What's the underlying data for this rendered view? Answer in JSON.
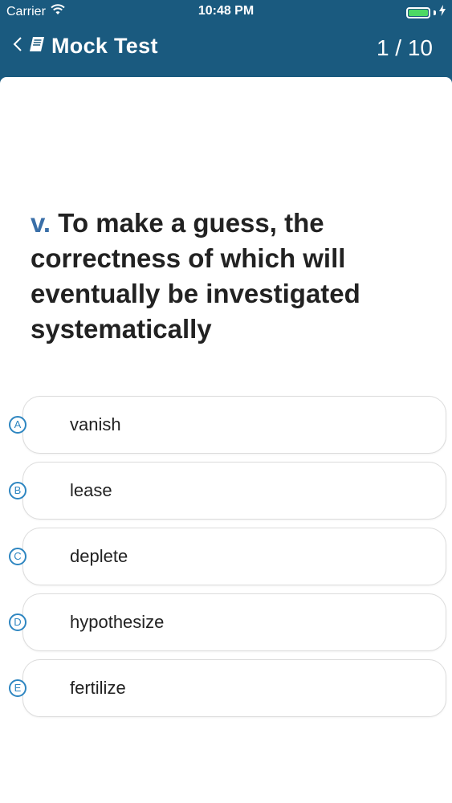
{
  "status_bar": {
    "carrier": "Carrier",
    "time": "10:48 PM",
    "icons": [
      "wifi-icon",
      "battery-icon",
      "charging-bolt-icon"
    ],
    "battery_color": "#4cd964"
  },
  "nav": {
    "back_icon": "chevron-left-icon",
    "book_icon": "book-icon",
    "title": "Mock Test",
    "progress": "1 / 10",
    "background": "#1a5a7f"
  },
  "question": {
    "number": "v.",
    "text": "To make a guess, the correctness of which will eventually be investigated systematically"
  },
  "options": [
    {
      "letter": "A",
      "text": "vanish"
    },
    {
      "letter": "B",
      "text": "lease"
    },
    {
      "letter": "C",
      "text": "deplete"
    },
    {
      "letter": "D",
      "text": "hypothesize"
    },
    {
      "letter": "E",
      "text": "fertilize"
    }
  ],
  "colors": {
    "accent": "#2e86c1",
    "question_number": "#3a6fa8"
  }
}
